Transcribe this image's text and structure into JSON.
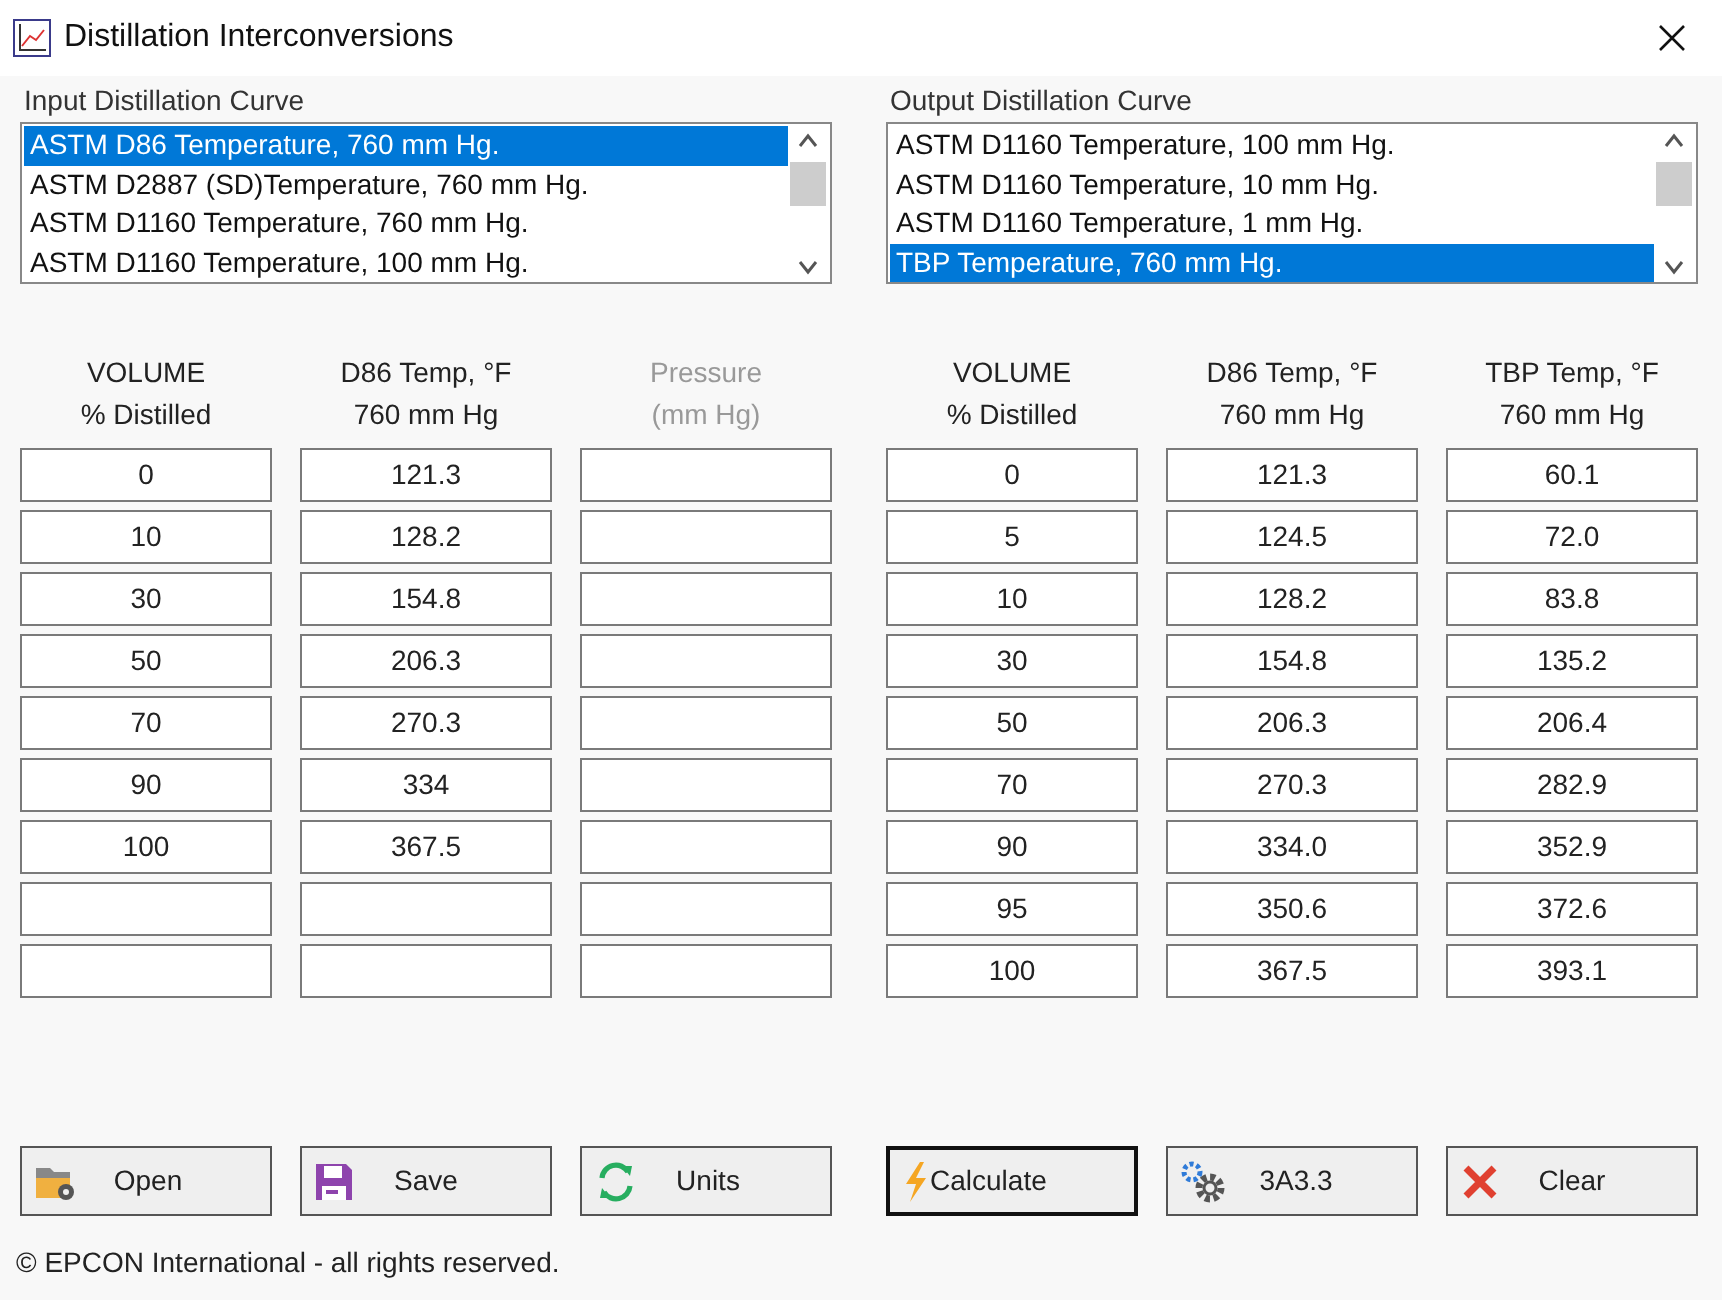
{
  "window": {
    "title": "Distillation Interconversions"
  },
  "input": {
    "label": "Input Distillation Curve",
    "list": [
      {
        "text": "ASTM D86 Temperature, 760 mm Hg.",
        "selected": true
      },
      {
        "text": "ASTM D2887 (SD)Temperature, 760 mm Hg.",
        "selected": false
      },
      {
        "text": "ASTM D1160 Temperature, 760 mm Hg.",
        "selected": false
      },
      {
        "text": "ASTM D1160 Temperature, 100 mm Hg.",
        "selected": false
      }
    ],
    "columns": [
      {
        "heading": [
          "VOLUME",
          "% Distilled"
        ],
        "disabled": false
      },
      {
        "heading": [
          "D86 Temp, °F",
          "760 mm Hg"
        ],
        "disabled": false
      },
      {
        "heading": [
          "Pressure",
          "(mm Hg)"
        ],
        "disabled": true
      }
    ],
    "rows": [
      [
        "0",
        "121.3",
        null
      ],
      [
        "10",
        "128.2",
        null
      ],
      [
        "30",
        "154.8",
        null
      ],
      [
        "50",
        "206.3",
        null
      ],
      [
        "70",
        "270.3",
        null
      ],
      [
        "90",
        "334",
        null
      ],
      [
        "100",
        "367.5",
        null
      ],
      [
        null,
        null,
        null
      ],
      [
        null,
        null,
        null
      ]
    ]
  },
  "output": {
    "label": "Output Distillation Curve",
    "list": [
      {
        "text": "ASTM D1160 Temperature, 100 mm Hg.",
        "selected": false
      },
      {
        "text": "ASTM D1160 Temperature, 10 mm Hg.",
        "selected": false
      },
      {
        "text": "ASTM D1160 Temperature, 1 mm Hg.",
        "selected": false
      },
      {
        "text": "TBP Temperature, 760 mm Hg.",
        "selected": true
      }
    ],
    "columns": [
      {
        "heading": [
          "VOLUME",
          "% Distilled"
        ],
        "disabled": false
      },
      {
        "heading": [
          "D86 Temp, °F",
          "760 mm Hg"
        ],
        "disabled": false
      },
      {
        "heading": [
          "TBP Temp, °F",
          "760 mm Hg"
        ],
        "disabled": false
      }
    ],
    "rows": [
      [
        "0",
        "121.3",
        "60.1"
      ],
      [
        "5",
        "124.5",
        "72.0"
      ],
      [
        "10",
        "128.2",
        "83.8"
      ],
      [
        "30",
        "154.8",
        "135.2"
      ],
      [
        "50",
        "206.3",
        "206.4"
      ],
      [
        "70",
        "270.3",
        "282.9"
      ],
      [
        "90",
        "334.0",
        "352.9"
      ],
      [
        "95",
        "350.6",
        "372.6"
      ],
      [
        "100",
        "367.5",
        "393.1"
      ]
    ]
  },
  "buttons": [
    {
      "label": "Open",
      "kind": "open",
      "focused": false
    },
    {
      "label": "Save",
      "kind": "save",
      "focused": false
    },
    {
      "label": "Units",
      "kind": "units",
      "focused": false
    },
    {
      "label": "Calculate",
      "kind": "calculate",
      "focused": true
    },
    {
      "label": "3A3.3",
      "kind": "gear",
      "focused": false
    },
    {
      "label": "Clear",
      "kind": "clear",
      "focused": false
    }
  ],
  "footer": "© EPCON International - all rights reserved."
}
